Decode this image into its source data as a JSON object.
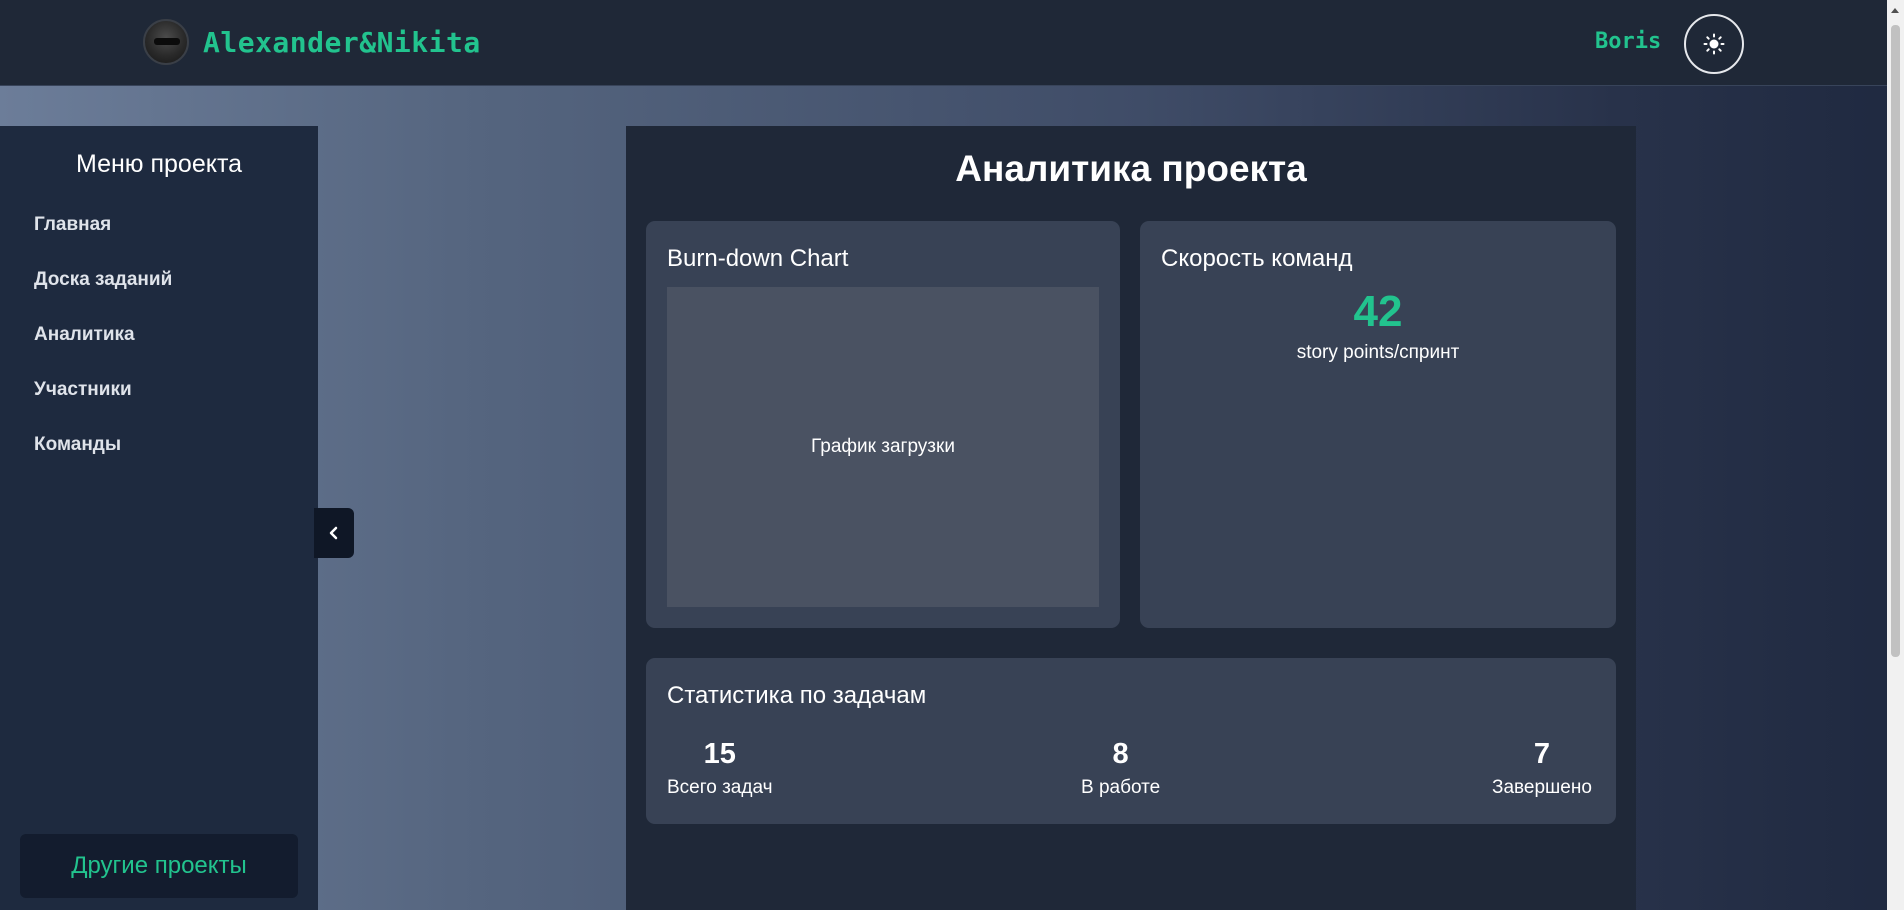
{
  "header": {
    "brand_name": "Alexander&Nikita",
    "user_name": "Boris",
    "theme_icon": "sun-icon"
  },
  "sidebar": {
    "title": "Меню проекта",
    "items": [
      {
        "label": "Главная"
      },
      {
        "label": "Доска заданий"
      },
      {
        "label": "Аналитика"
      },
      {
        "label": "Участники"
      },
      {
        "label": "Команды"
      }
    ],
    "other_projects_label": "Другие проекты",
    "collapse_icon": "chevron-left-icon"
  },
  "main": {
    "title": "Аналитика проекта",
    "burndown": {
      "title": "Burn-down Chart",
      "placeholder": "График загрузки"
    },
    "velocity": {
      "title": "Скорость команд",
      "value": "42",
      "unit": "story points/спринт"
    },
    "task_stats": {
      "title": "Статистика по задачам",
      "items": [
        {
          "value": "15",
          "label": "Всего задач"
        },
        {
          "value": "8",
          "label": "В работе"
        },
        {
          "value": "7",
          "label": "Завершено"
        }
      ]
    }
  },
  "colors": {
    "accent": "#22c38e",
    "header_bg": "#1f2837",
    "sidebar_bg": "#1e2a3f",
    "card_bg": "#384255"
  }
}
